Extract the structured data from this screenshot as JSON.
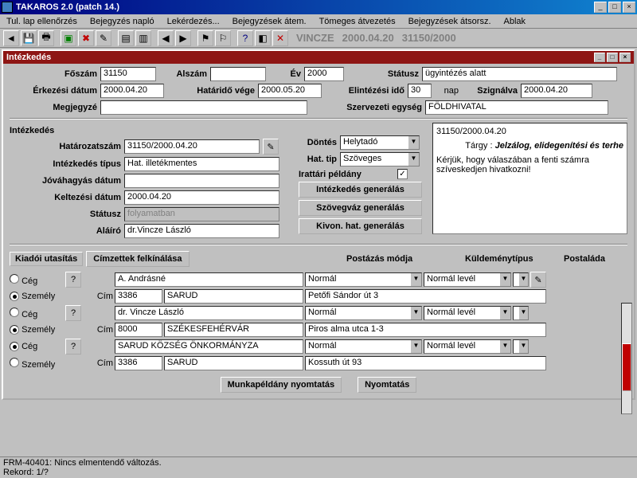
{
  "window": {
    "title": "TAKAROS 2.0 (patch 14.)"
  },
  "menu": {
    "m1": "Tul. lap ellenőrzés",
    "m2": "Bejegyzés napló",
    "m3": "Lekérdezés...",
    "m4": "Bejegyzések átem.",
    "m5": "Tömeges átvezetés",
    "m6": "Bejegyzések átsorsz.",
    "m7": "Ablak"
  },
  "toolbarInfo": {
    "user": "VINCZE",
    "date": "2000.04.20",
    "ref": "31150/2000"
  },
  "subwindow": {
    "title": "Intézkedés"
  },
  "labels": {
    "foszam": "Főszám",
    "alszam": "Alszám",
    "ev": "Év",
    "statusz": "Státusz",
    "erk": "Érkezési dátum",
    "hatvege": "Határidő vége",
    "elint": "Elintézési idő",
    "nap": "nap",
    "szign": "Szignálva",
    "megj": "Megjegyzé",
    "szerv": "Szervezeti egység",
    "intezk": "Intézkedés",
    "hatsz": "Határozatszám",
    "itipus": "Intézkedés típus",
    "jov": "Jóváhagyás dátum",
    "kelt": "Keltezési dátum",
    "statusz2": "Státusz",
    "alairo": "Aláíró",
    "dontes": "Döntés",
    "hattip": "Hat. tip",
    "iratt": "Irattári példány",
    "gen1": "Intézkedés generálás",
    "gen2": "Szövegváz generálás",
    "gen3": "Kivon. hat. generálás",
    "kiado": "Kiadói utasítás",
    "cimz": "Címzettek felkínálása",
    "post": "Postázás módja",
    "kuld": "Küldeménytípus",
    "plad": "Postaláda",
    "ceg": "Cég",
    "szem": "Személy",
    "cim": "Cím",
    "munka": "Munkapéldány nyomtatás",
    "nyom": "Nyomtatás"
  },
  "values": {
    "foszam": "31150",
    "alszam": "",
    "ev": "2000",
    "statusz": "ügyintézés alatt",
    "erk": "2000.04.20",
    "hatvege": "2000.05.20",
    "elint": "30",
    "szign": "2000.04.20",
    "megj": "",
    "szerv": "FÖLDHIVATAL",
    "hatsz": "31150/2000.04.20",
    "itipus": "Hat. illetékmentes",
    "jov": "",
    "kelt": "2000.04.20",
    "statusz2": "folyamatban",
    "alairo": "dr.Vincze László",
    "dontes": "Helytadó",
    "hattip": "Szöveges"
  },
  "preview": {
    "ref": "31150/2000.04.20",
    "targylabel": "Tárgy :",
    "targy": "Jelzálog, elidegenítési és terhe",
    "body": "Kérjük, hogy válaszában a fenti számra szíveskedjen hivatkozni!"
  },
  "postNormal": "Normál",
  "kuldNormal": "Normál levél",
  "rows": [
    {
      "name": "A. Andrásné",
      "zip": "3386",
      "city": "SARUD",
      "street": "Petőfi Sándor út 3"
    },
    {
      "name": "dr. Vincze László",
      "zip": "8000",
      "city": "SZÉKESFEHÉRVÁR",
      "street": "Piros alma utca 1-3"
    },
    {
      "name": "SARUD KÖZSÉG ÖNKORMÁNYZA",
      "zip": "3386",
      "city": "SARUD",
      "street": "Kossuth út 93"
    }
  ],
  "status": {
    "l1": "FRM-40401: Nincs elmentendő változás.",
    "l2": "Rekord: 1/?"
  }
}
